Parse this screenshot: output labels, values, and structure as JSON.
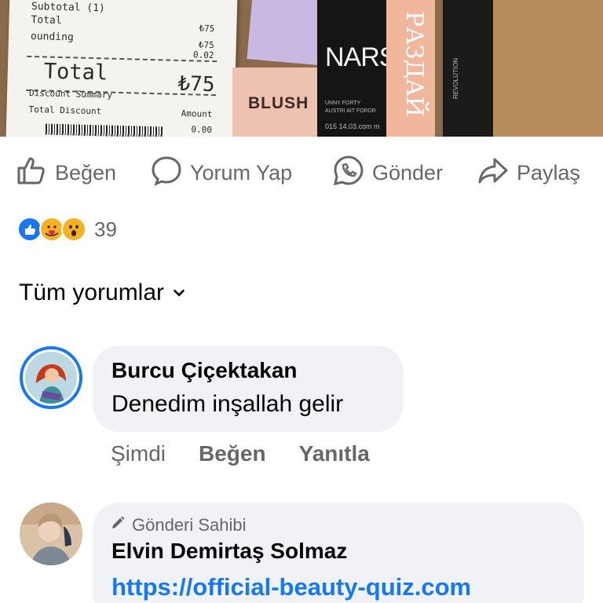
{
  "post_image": {
    "receipt": {
      "subtotal_label": "Subtotal (1)",
      "total_small_label": "Total",
      "rounding_label": "ounding",
      "subtotal_value": "₺75",
      "total_small_value": "₺75",
      "rounding_value": "0.02",
      "total_label": "Total",
      "total_value": "₺75",
      "discount_summary_label": "Discount Summary",
      "amount_label": "Amount",
      "total_discount_label": "Total Discount",
      "total_discount_value": "0.00"
    },
    "products": {
      "blush_label": "BLUSH",
      "nars_brand": "NARS",
      "nars_small_1": "UNNY FORTY",
      "nars_small_2": "AUSTRI AIT FORDR",
      "nars_code": "015 14.03.com m",
      "peach_label": "РАЗДАЙ",
      "black2_label": "REVOLUTION"
    }
  },
  "actions": {
    "like": "Beğen",
    "comment": "Yorum Yap",
    "send": "Gönder",
    "share": "Paylaş"
  },
  "reactions": {
    "count": "39"
  },
  "all_comments_label": "Tüm yorumlar",
  "comments": [
    {
      "name": "Burcu Çiçektakan",
      "text": "Denedim inşallah gelir",
      "time": "Şimdi",
      "like": "Beğen",
      "reply": "Yanıtla"
    },
    {
      "badge": "Gönderi Sahibi",
      "name": "Elvin Demirtaş Solmaz",
      "link": "https://official-beauty-quiz.com"
    }
  ],
  "colors": {
    "accent": "#1877f2",
    "secondary_text": "#65676b",
    "bubble": "#f0f2f5"
  }
}
